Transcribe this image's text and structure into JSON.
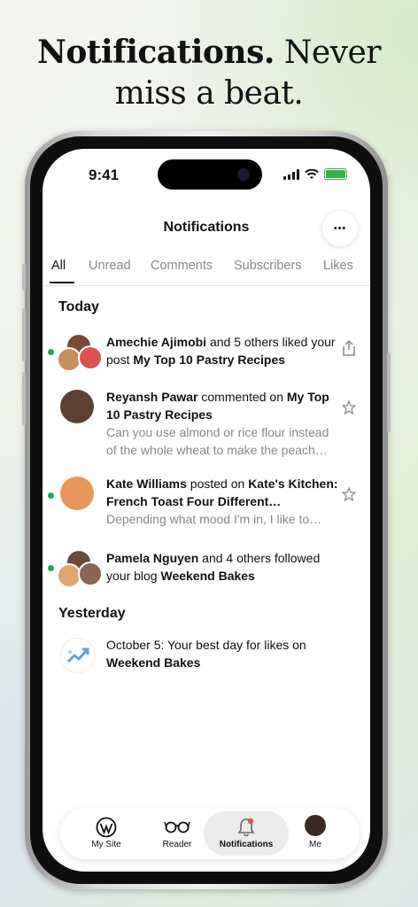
{
  "headline": {
    "bold": "Notifications.",
    "rest_line1": " Never",
    "line2": "miss a beat."
  },
  "status": {
    "time": "9:41"
  },
  "screen": {
    "title": "Notifications",
    "more_label": "•••"
  },
  "tabs": [
    {
      "label": "All",
      "active": true
    },
    {
      "label": "Unread",
      "active": false
    },
    {
      "label": "Comments",
      "active": false
    },
    {
      "label": "Subscribers",
      "active": false
    },
    {
      "label": "Likes",
      "active": false
    }
  ],
  "sections": {
    "today": "Today",
    "yesterday": "Yesterday"
  },
  "notifications": [
    {
      "name": "Amechie Ajimobi",
      "mid": " and 5 others liked your post ",
      "target": "My Top 10 Pastry Recipes",
      "excerpt": "",
      "unread": true,
      "action_icon": "share-icon"
    },
    {
      "name": "Reyansh Pawar",
      "mid": " commented on ",
      "target": "My Top 10 Pastry Recipes",
      "excerpt": "Can you use almond or rice flour instead of the whole wheat to make the peach…",
      "unread": false,
      "action_icon": "star-icon"
    },
    {
      "name": "Kate Williams",
      "mid": " posted on ",
      "target": "Kate's Kitchen: French Toast Four Different…",
      "excerpt": "Depending what mood I'm in, I like to…",
      "unread": true,
      "action_icon": "star-icon"
    },
    {
      "name": "Pamela Nguyen",
      "mid": " and 4 others followed your blog ",
      "target": "Weekend Bakes",
      "excerpt": "",
      "unread": true,
      "action_icon": ""
    },
    {
      "name": "",
      "mid": "October 5: Your best day for likes on ",
      "target": "Weekend Bakes",
      "excerpt": "",
      "unread": false,
      "action_icon": "trend-icon"
    }
  ],
  "bottom_nav": [
    {
      "label": "My Site",
      "icon": "wordpress-icon"
    },
    {
      "label": "Reader",
      "icon": "glasses-icon"
    },
    {
      "label": "Notifications",
      "icon": "bell-icon",
      "active": true
    },
    {
      "label": "Me",
      "icon": "avatar"
    }
  ],
  "colors": {
    "unread_dot": "#1fa84f",
    "active_tab_bg": "#ececec",
    "battery": "#38b24a"
  }
}
